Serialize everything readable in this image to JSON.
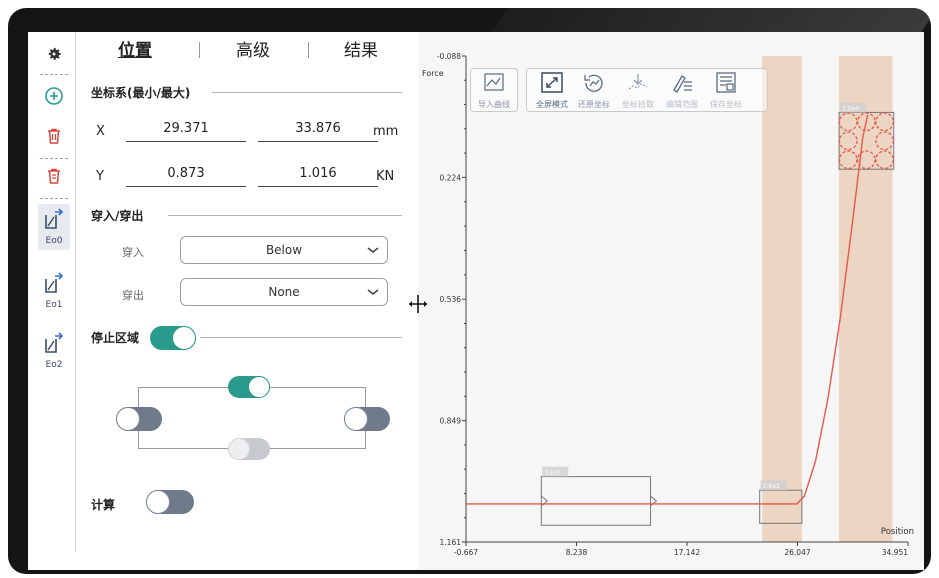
{
  "sidebar": {
    "items": [
      {
        "icon": "gear-icon"
      },
      {
        "icon": "add-circle-icon"
      },
      {
        "icon": "delete-icon"
      },
      {
        "icon": "delete-all-icon"
      },
      {
        "icon": "envelope-icon",
        "label": "Eo0"
      },
      {
        "icon": "envelope-icon",
        "label": "Eo1"
      },
      {
        "icon": "envelope-icon",
        "label": "Eo2"
      }
    ]
  },
  "tabs": [
    {
      "label": "位置",
      "active": true
    },
    {
      "label": "高级",
      "active": false
    },
    {
      "label": "结果",
      "active": false
    }
  ],
  "coords": {
    "section_title": "坐标系(最小/最大)",
    "x_label": "X",
    "x_min": "29.371",
    "x_max": "33.876",
    "x_unit": "mm",
    "y_label": "Y",
    "y_min": "0.873",
    "y_max": "1.016",
    "y_unit": "KN"
  },
  "pass": {
    "section_title": "穿入/穿出",
    "entry_label": "穿入",
    "entry_value": "Below",
    "exit_label": "穿出",
    "exit_value": "None"
  },
  "stop_zone": {
    "label": "停止区域",
    "enabled": true,
    "top": "on",
    "left": "off",
    "right": "off",
    "bottom": "disabled"
  },
  "calc": {
    "label": "计算",
    "enabled": false
  },
  "toolbar": {
    "items": [
      {
        "icon": "import-curve-icon",
        "label": "导入曲线"
      },
      {
        "icon": "fullscreen-icon",
        "label": "全屏模式"
      },
      {
        "icon": "restore-coords-icon",
        "label": "还原坐标"
      },
      {
        "icon": "pick-coords-icon",
        "label": "坐标拾取"
      },
      {
        "icon": "edit-range-icon",
        "label": "编辑范围"
      },
      {
        "icon": "save-coords-icon",
        "label": "保存坐标"
      }
    ]
  },
  "chart": {
    "y_axis_label": "Force",
    "x_axis_label": "Position",
    "y_ticks": [
      "1.161",
      "0.849",
      "0.536",
      "0.224",
      "-0.088"
    ],
    "x_ticks": [
      "-0.667",
      "8.238",
      "17.142",
      "26.047",
      "34.951"
    ],
    "box_labels": [
      "1:Eo1",
      "1:Eo2",
      "1:Eo0"
    ],
    "colors": {
      "curve": "#e8584a",
      "band": "#e8c9b0",
      "toggle_on": "#2a9a8c",
      "toggle_off": "#6f7b8b"
    }
  },
  "chart_data": {
    "type": "line",
    "xlabel": "Position",
    "ylabel": "Force",
    "xlim": [
      -0.667,
      34.951
    ],
    "ylim": [
      -0.088,
      1.161
    ],
    "x_ticks": [
      -0.667,
      8.238,
      17.142,
      26.047,
      34.951
    ],
    "y_ticks": [
      -0.088,
      0.224,
      0.536,
      0.849,
      1.161
    ],
    "series": [
      {
        "x": [
          -0.667,
          5,
          10,
          15,
          20,
          24,
          26.0,
          26.6,
          27.5,
          28.5,
          29.5,
          30.5,
          31.3,
          31.7
        ],
        "y": [
          0.01,
          0.01,
          0.01,
          0.01,
          0.01,
          0.01,
          0.01,
          0.03,
          0.12,
          0.28,
          0.49,
          0.74,
          0.95,
          1.01
        ]
      }
    ],
    "bands": [
      {
        "x_min": 23.2,
        "x_max": 26.4
      },
      {
        "x_min": 29.4,
        "x_max": 33.7
      }
    ],
    "boxes": [
      {
        "label": "1:Eo1",
        "x_min": 5.4,
        "x_max": 14.2,
        "y_min": -0.045,
        "y_max": 0.08
      },
      {
        "label": "1:Eo2",
        "x_min": 23.0,
        "x_max": 26.4,
        "y_min": -0.04,
        "y_max": 0.045
      },
      {
        "label": "1:Eo0",
        "x_min": 29.4,
        "x_max": 33.8,
        "y_min": 0.87,
        "y_max": 1.016
      }
    ]
  }
}
